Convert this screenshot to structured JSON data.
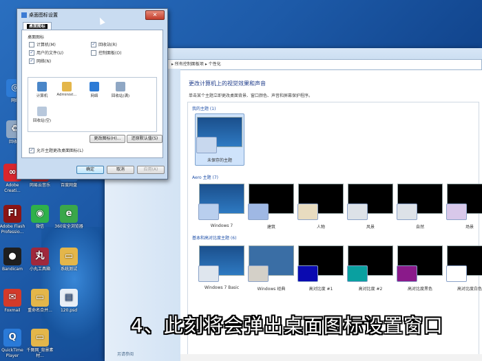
{
  "desktop": {
    "icons": [
      {
        "label": "网络",
        "icon": "network-icon",
        "color": "#2d7bd6"
      },
      {
        "label": "回收站",
        "icon": "recycle-bin-icon",
        "color": "#8fa7c4"
      },
      {
        "label": "Adobe Creati...",
        "icon": "adobe-creative-cloud-icon",
        "color": "#d8262d"
      },
      {
        "label": "网易云音乐",
        "icon": "music-icon",
        "color": "#c9262c"
      },
      {
        "label": "百度网盘",
        "icon": "cloud-drive-icon",
        "color": "#2f7fe0"
      },
      {
        "label": "Adobe Flash Professio...",
        "icon": "flash-icon",
        "color": "#8b1515"
      },
      {
        "label": "微信",
        "icon": "wechat-icon",
        "color": "#2fb14a"
      },
      {
        "label": "360安全浏览器",
        "icon": "browser-icon",
        "color": "#3aa74a"
      },
      {
        "label": "Bandicam",
        "icon": "bandicam-icon",
        "color": "#1f1f1f"
      },
      {
        "label": "小丸工具箱",
        "icon": "toolbox-icon",
        "color": "#a0283c"
      },
      {
        "label": "系统测试",
        "icon": "folder-icon",
        "color": "#e4b64a"
      },
      {
        "label": "Foxmail",
        "icon": "foxmail-icon",
        "color": "#d33a2a"
      },
      {
        "label": "重命名合并...",
        "icon": "folder-icon",
        "color": "#e4b64a"
      },
      {
        "label": "120.psd",
        "icon": "psd-file-icon",
        "color": "#e8eef6"
      },
      {
        "label": "QuickTime Player",
        "icon": "quicktime-icon",
        "color": "#2a7ad8"
      },
      {
        "label": "千图网_背景素材...",
        "icon": "folder-icon",
        "color": "#e4b64a"
      }
    ]
  },
  "personalize": {
    "breadcrumb": "▸ 所有控制面板项  ▸ 个性化",
    "heading": "更改计算机上的视觉效果和声音",
    "subheading": "单击某个主题立即更改桌面背景、窗口颜色、声音和屏幕保护程序。",
    "sections": {
      "my": "我的主题 (1)",
      "aero": "Aero 主题 (7)",
      "basic": "基本和高对比度主题 (6)"
    },
    "my_themes": [
      {
        "label": "未保存的主题"
      }
    ],
    "aero_themes": [
      {
        "label": "Windows 7"
      },
      {
        "label": "建筑"
      },
      {
        "label": "人物"
      },
      {
        "label": "风景"
      },
      {
        "label": "自然"
      },
      {
        "label": "场景"
      }
    ],
    "basic_themes": [
      {
        "label": "Windows 7 Basic"
      },
      {
        "label": "Windows 经典"
      },
      {
        "label": "高对比度 #1"
      },
      {
        "label": "高对比度 #2"
      },
      {
        "label": "高对比度黑色"
      },
      {
        "label": "高对比度白色"
      }
    ],
    "see_also": "另请参阅"
  },
  "dialog": {
    "title": "桌面图标设置",
    "close": "✕",
    "tab": "桌面图标",
    "group_label": "桌面图标",
    "checkboxes": [
      {
        "label": "计算机(M)",
        "checked": false
      },
      {
        "label": "回收站(R)",
        "checked": true
      },
      {
        "label": "用户的文件(U)",
        "checked": true
      },
      {
        "label": "控制面板(O)",
        "checked": false
      },
      {
        "label": "网络(N)",
        "checked": true
      }
    ],
    "icons": [
      {
        "label": "计算机",
        "color": "#4a86c8"
      },
      {
        "label": "Administ...",
        "color": "#e4b64a"
      },
      {
        "label": "网络",
        "color": "#2d7bd6"
      },
      {
        "label": "回收站(满)",
        "color": "#8fa7c4"
      },
      {
        "label": "回收站(空)",
        "color": "#b8c8dc"
      }
    ],
    "change_icon": "更改图标(H)...",
    "restore_default": "还原默认值(S)",
    "allow_themes": "允许主题更改桌面图标(L)",
    "allow_themes_checked": "✓",
    "ok": "确定",
    "cancel": "取消",
    "apply": "应用(A)"
  },
  "caption": "4、此刻将会弹出桌面图标设置窗口"
}
